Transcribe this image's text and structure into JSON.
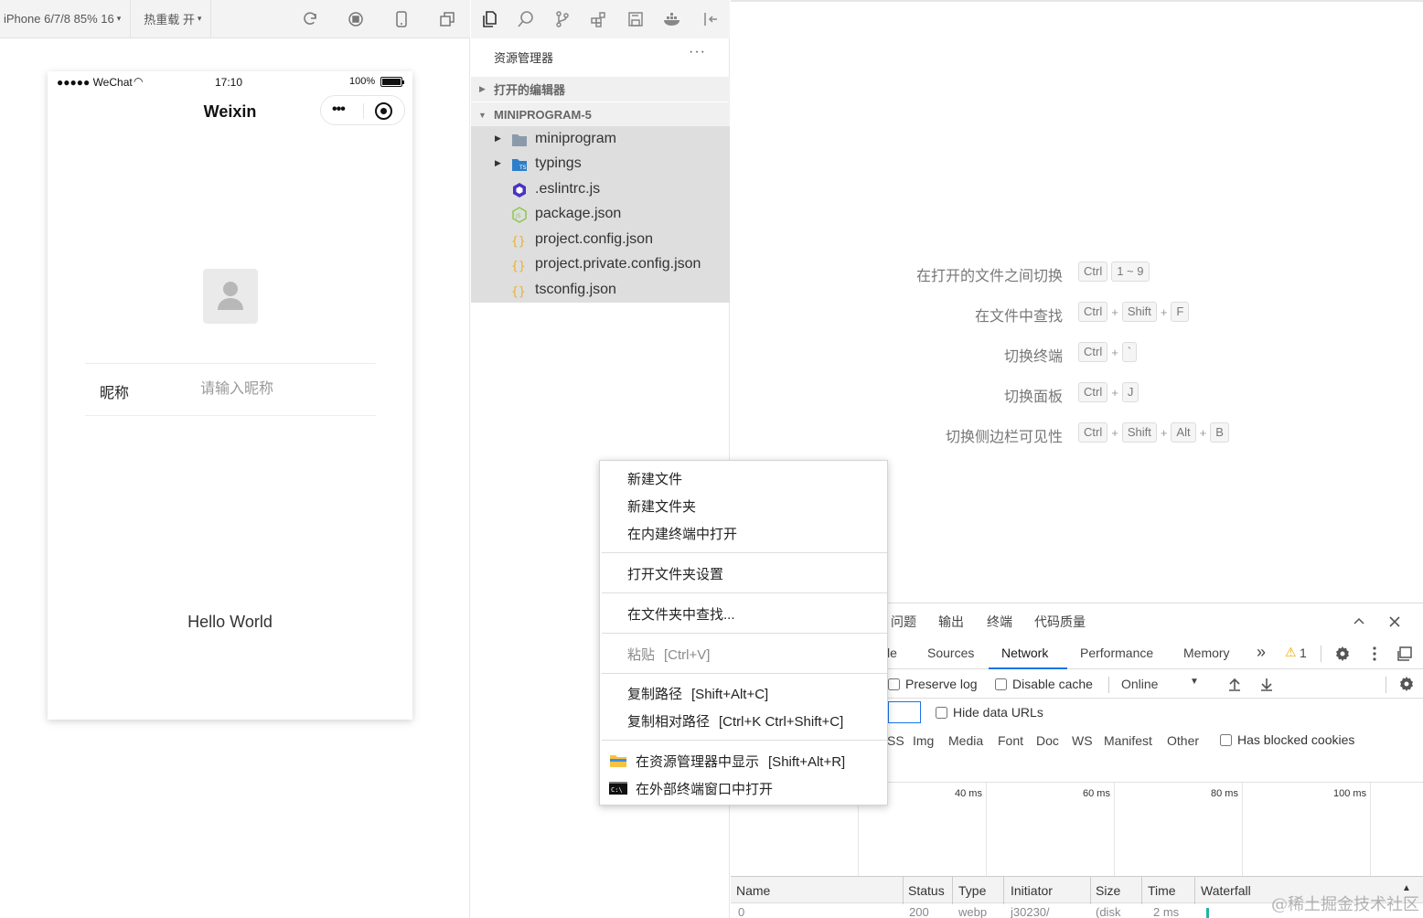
{
  "simulator": {
    "device_select": "iPhone 6/7/8 85% 16",
    "hot_reload": "热重载 开",
    "phone": {
      "carrier": "●●●●● WeChat",
      "time": "17:10",
      "battery": "100%",
      "nav_title": "Weixin",
      "nickname_label": "昵称",
      "nickname_placeholder": "请输入昵称",
      "hello": "Hello World"
    }
  },
  "explorer": {
    "title": "资源管理器",
    "more": "···",
    "open_editors": "打开的编辑器",
    "project": "MINIPROGRAM-5",
    "files": [
      {
        "name": "miniprogram",
        "icon": "folder-icon",
        "expandable": true
      },
      {
        "name": "typings",
        "icon": "ts-folder-icon",
        "expandable": true
      },
      {
        "name": ".eslintrc.js",
        "icon": "eslint-icon",
        "expandable": false
      },
      {
        "name": "package.json",
        "icon": "nodejs-icon",
        "expandable": false
      },
      {
        "name": "project.config.json",
        "icon": "json-icon",
        "expandable": false
      },
      {
        "name": "project.private.config.json",
        "icon": "json-icon",
        "expandable": false
      },
      {
        "name": "tsconfig.json",
        "icon": "json-icon",
        "expandable": false
      }
    ]
  },
  "editor": {
    "shortcuts": [
      {
        "label": "在打开的文件之间切换",
        "keys": [
          "Ctrl",
          "1 ~ 9"
        ],
        "joiner": ""
      },
      {
        "label": "在文件中查找",
        "keys": [
          "Ctrl",
          "Shift",
          "F"
        ],
        "joiner": "+"
      },
      {
        "label": "切换终端",
        "keys": [
          "Ctrl",
          "`"
        ],
        "joiner": "+"
      },
      {
        "label": "切换面板",
        "keys": [
          "Ctrl",
          "J"
        ],
        "joiner": "+"
      },
      {
        "label": "切换侧边栏可见性",
        "keys": [
          "Ctrl",
          "Shift",
          "Alt",
          "B"
        ],
        "joiner": "+"
      }
    ]
  },
  "context_menu": {
    "new_file": "新建文件",
    "new_folder": "新建文件夹",
    "open_in_terminal": "在内建终端中打开",
    "folder_settings": "打开文件夹设置",
    "find_in_folder": "在文件夹中查找...",
    "paste": "粘贴",
    "paste_key": "[Ctrl+V]",
    "copy_path": "复制路径",
    "copy_path_key": "[Shift+Alt+C]",
    "copy_rel_path": "复制相对路径",
    "copy_rel_path_key": "[Ctrl+K Ctrl+Shift+C]",
    "reveal_in_explorer": "在资源管理器中显示",
    "reveal_key": "[Shift+Alt+R]",
    "open_external_terminal": "在外部终端窗口中打开"
  },
  "devtools": {
    "panel_tabs": [
      "问题",
      "输出",
      "终端",
      "代码质量"
    ],
    "tabs": {
      "console_partial": "le",
      "sources": "Sources",
      "network": "Network",
      "performance": "Performance",
      "memory": "Memory",
      "more": "»",
      "warnings": "1"
    },
    "toolbar": {
      "preserve_log": "Preserve log",
      "disable_cache": "Disable cache",
      "throttle": "Online"
    },
    "hide_data_urls": "Hide data URLs",
    "filters": [
      "SS",
      "Img",
      "Media",
      "Font",
      "Doc",
      "WS",
      "Manifest",
      "Other"
    ],
    "has_blocked_cookies": "Has blocked cookies",
    "timeline_ticks": [
      "40 ms",
      "60 ms",
      "80 ms",
      "100 ms"
    ],
    "columns": [
      "Name",
      "Status",
      "Type",
      "Initiator",
      "Size",
      "Time",
      "Waterfall"
    ],
    "row": {
      "name": "0",
      "status": "200",
      "type": "webp",
      "initiator": "j30230/",
      "size": "(disk",
      "time": "2 ms"
    }
  },
  "watermark": "@稀土掘金技术社区",
  "colors": {
    "accent_blue": "#1a73e8",
    "folder": "#8a9aa9",
    "json": "#e8b130",
    "warning": "#f2a600"
  }
}
